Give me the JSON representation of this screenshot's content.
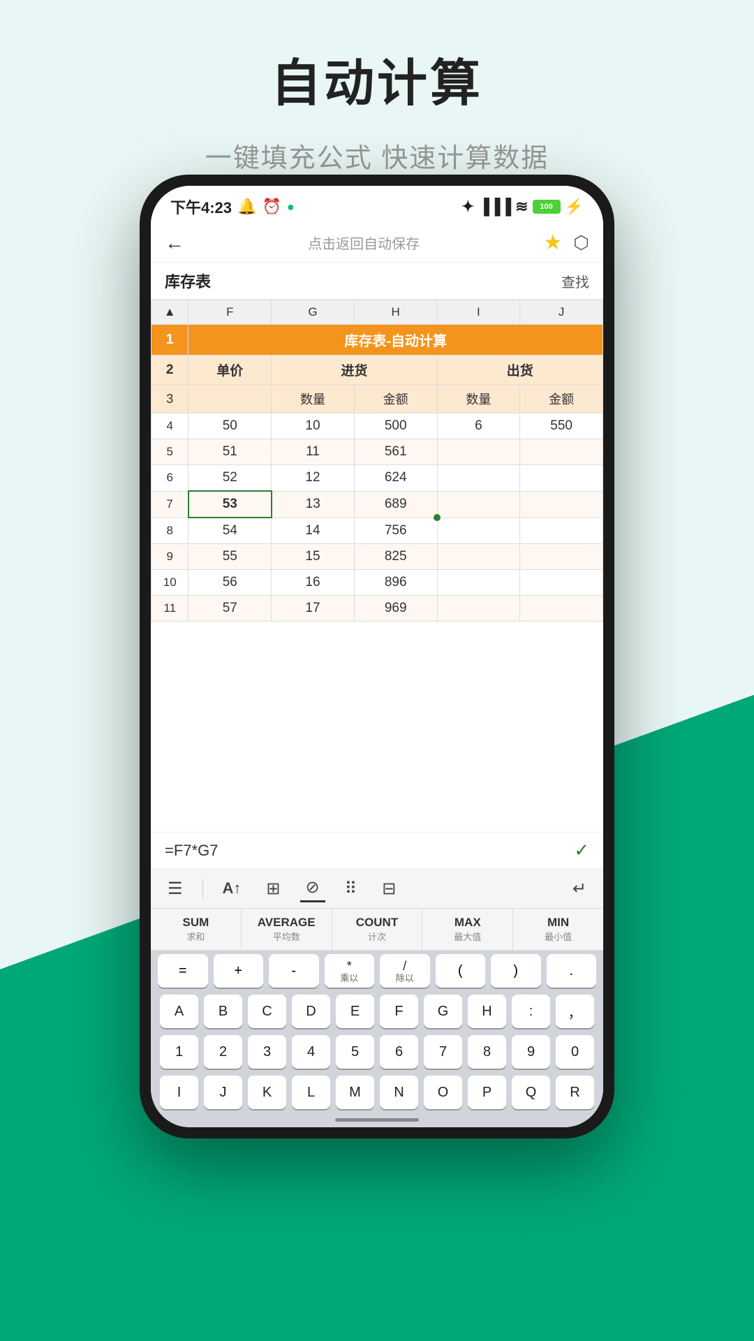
{
  "page": {
    "title": "自动计算",
    "subtitle": "一键填充公式 快速计算数据"
  },
  "statusBar": {
    "time": "下午4:23",
    "battery": "100"
  },
  "topBar": {
    "centerText": "点击返回自动保存"
  },
  "toolbar": {
    "title": "库存表",
    "findLabel": "查找"
  },
  "spreadsheet": {
    "sheetTitle": "库存表-自动计算",
    "colHeaders": [
      "F",
      "G",
      "H",
      "I",
      "J"
    ],
    "row2": [
      "单价",
      "进货",
      "",
      "出货",
      ""
    ],
    "row3": [
      "",
      "数量",
      "金额",
      "数量",
      "金额"
    ],
    "rows": [
      {
        "num": "4",
        "f": "50",
        "g": "10",
        "h": "500",
        "i": "6",
        "j": "550"
      },
      {
        "num": "5",
        "f": "51",
        "g": "11",
        "h": "561",
        "i": "",
        "j": ""
      },
      {
        "num": "6",
        "f": "52",
        "g": "12",
        "h": "624",
        "i": "",
        "j": ""
      },
      {
        "num": "7",
        "f": "53",
        "g": "13",
        "h": "689",
        "i": "",
        "j": ""
      },
      {
        "num": "8",
        "f": "54",
        "g": "14",
        "h": "756",
        "i": "",
        "j": ""
      },
      {
        "num": "9",
        "f": "55",
        "g": "15",
        "h": "825",
        "i": "",
        "j": ""
      },
      {
        "num": "10",
        "f": "56",
        "g": "16",
        "h": "896",
        "i": "",
        "j": ""
      },
      {
        "num": "11",
        "f": "57",
        "g": "17",
        "h": "969",
        "i": "",
        "j": ""
      }
    ]
  },
  "formulaBar": {
    "formula": "=F7*G7"
  },
  "kbToolbar": {
    "icons": [
      "☰",
      "A↑",
      "⊞",
      "⊡",
      "⊘",
      "⠿",
      "⊟",
      "↵"
    ]
  },
  "functions": [
    {
      "name": "SUM",
      "label": "求和"
    },
    {
      "name": "AVERAGE",
      "label": "平均数"
    },
    {
      "name": "COUNT",
      "label": "计次"
    },
    {
      "name": "MAX",
      "label": "最大值"
    },
    {
      "name": "MIN",
      "label": "最小值"
    }
  ],
  "opsRow": [
    "=",
    "+",
    "-",
    "×\n乘以",
    "/\n除以",
    "(",
    ")",
    "."
  ],
  "keyRows": [
    [
      "A",
      "B",
      "C",
      "D",
      "E",
      "F",
      "G",
      "H",
      ":",
      "，"
    ],
    [
      "1",
      "2",
      "3",
      "4",
      "5",
      "6",
      "7",
      "8",
      "9",
      "0"
    ],
    [
      "I",
      "J",
      "K",
      "L",
      "M",
      "N",
      "O",
      "P",
      "Q",
      "R"
    ]
  ]
}
